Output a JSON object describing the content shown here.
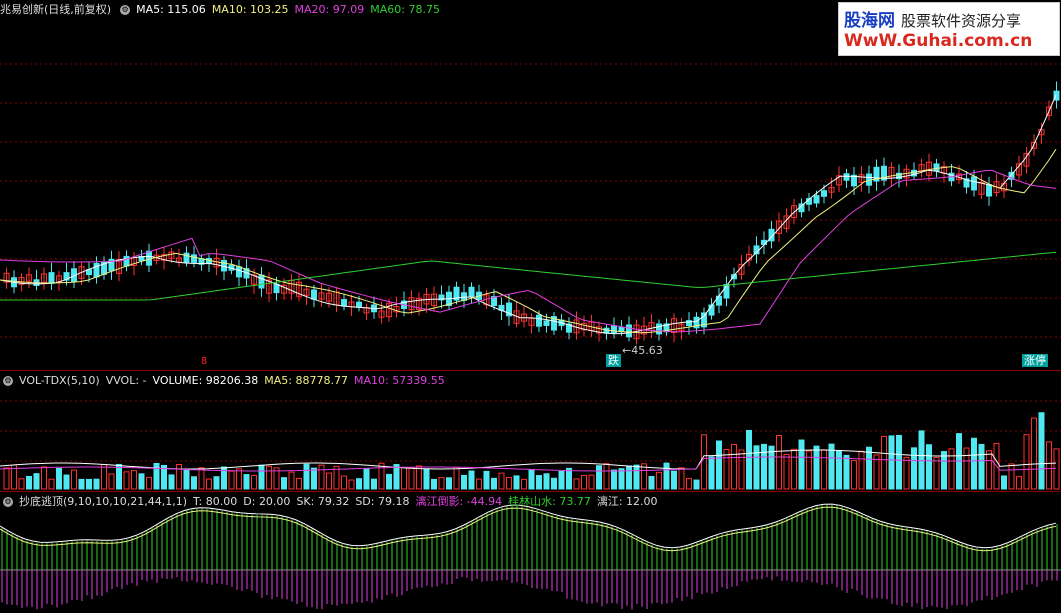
{
  "price": {
    "title": "兆易创新(日线,前复权)",
    "ma5": "MA5: 115.06",
    "ma10": "MA10: 103.25",
    "ma20": "MA20: 97.09",
    "ma60": "MA60: 78.75",
    "low_label": "45.63",
    "signal_down": "跌",
    "signal_up": "涨停",
    "red_tag": "8"
  },
  "volume": {
    "title": "VOL-TDX(5,10)",
    "vvol": "VVOL: -",
    "volume": "VOLUME: 98206.38",
    "ma5": "MA5: 88778.77",
    "ma10": "MA10: 57339.55"
  },
  "indicator": {
    "title": "抄底逃顶(9,10,10,10,21,44,1,1)",
    "t": "T: 80.00",
    "d": "D: 20.00",
    "sk": "SK: 79.32",
    "sd": "SD: 79.18",
    "lijiang_daoying": "漓江倒影: -44.94",
    "guilin_shanshui": "桂林山水: 73.77",
    "lijiang": "漓江: 12.00"
  },
  "watermark": {
    "brand": "股海网",
    "slogan": "股票软件资源分享",
    "url": "WwW.Guhai.com.cn"
  },
  "colors": {
    "up": "#ff3030",
    "down": "#50e8f0",
    "ma5": "#ffffff",
    "ma10": "#f0f080",
    "ma20": "#e040e0",
    "ma60": "#30d030",
    "grid": "#8b0000"
  }
}
